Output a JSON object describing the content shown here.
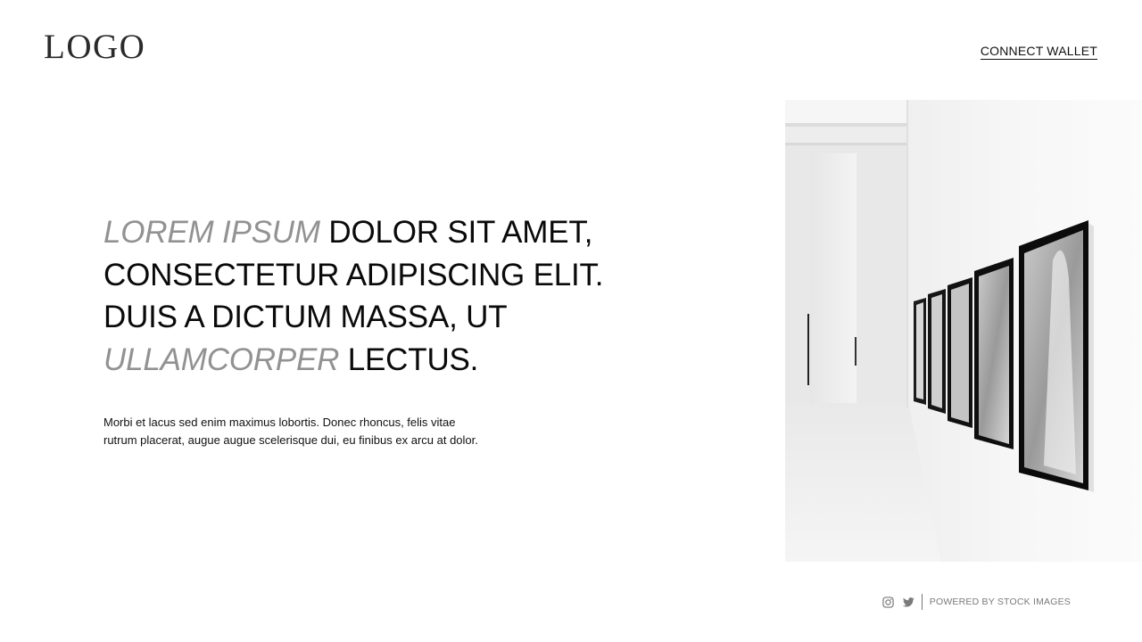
{
  "header": {
    "logo_text": "LOGO",
    "connect_wallet_label": "CONNECT WALLET"
  },
  "hero": {
    "headline": {
      "accent_1": "LOREM IPSUM",
      "text_1": " DOLOR SIT AMET,",
      "line_2": "CONSECTETUR ADIPISCING ELIT.",
      "line_3": "DUIS A DICTUM MASSA, UT",
      "accent_2": "ULLAMCORPER",
      "text_2": " LECTUS."
    },
    "body_line_1": "Morbi et lacus sed enim maximus lobortis. Donec rhoncus, felis vitae",
    "body_line_2": "rutrum placerat, augue augue scelerisque dui, eu finibus ex arcu at dolor."
  },
  "footer": {
    "icons": [
      "instagram-icon",
      "twitter-icon"
    ],
    "credit_text": "POWERED BY STOCK IMAGES"
  },
  "colors": {
    "accent_text": "#929292",
    "primary_text": "#0a0a0a",
    "background": "#ffffff"
  }
}
